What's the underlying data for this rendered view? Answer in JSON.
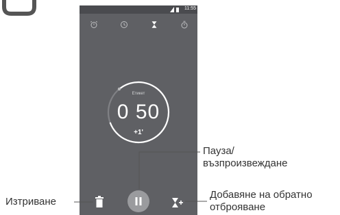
{
  "status_bar": {
    "time": "11:55"
  },
  "tabs": [
    {
      "name": "alarm",
      "icon": "alarm-icon"
    },
    {
      "name": "clock",
      "icon": "clock-icon"
    },
    {
      "name": "timer",
      "icon": "hourglass-icon",
      "active": true
    },
    {
      "name": "stopwatch",
      "icon": "stopwatch-icon"
    }
  ],
  "timer": {
    "label": "Етикет",
    "value": "0 50",
    "add_minute": "+1'"
  },
  "controls": {
    "delete_icon": "trash-icon",
    "pause_icon": "pause-icon",
    "add_icon": "add-timer-icon"
  },
  "callouts": {
    "pause_line1": "Пауза/",
    "pause_line2": "възпроизвеждане",
    "delete": "Изтриване",
    "add_line1": "Добавяне на обратно",
    "add_line2": "отброяване"
  },
  "colors": {
    "screen": "#5f6064",
    "statusbar": "#4a4b4f",
    "pause_button": "#9a9b9e",
    "callout_text": "#333333"
  }
}
